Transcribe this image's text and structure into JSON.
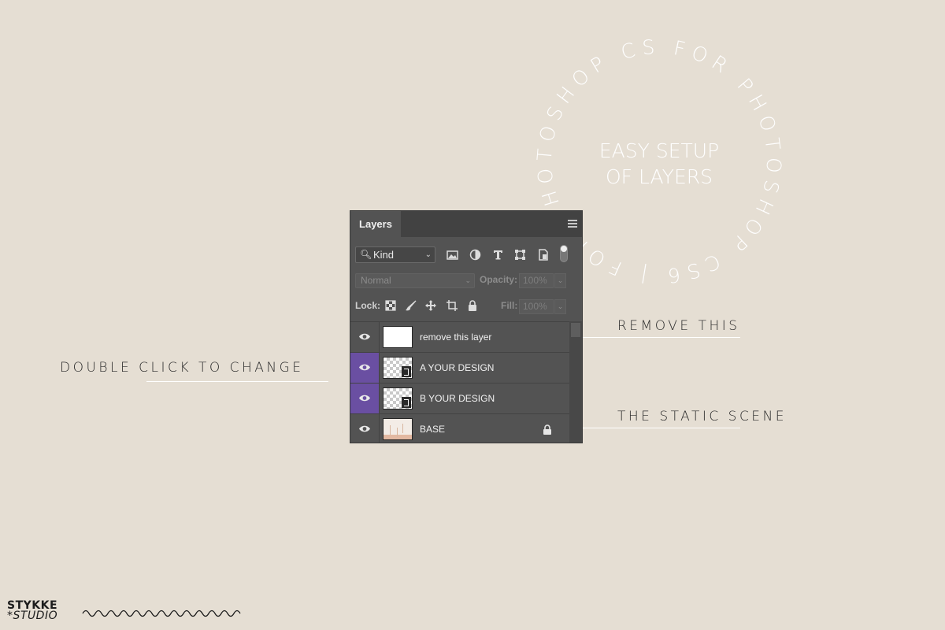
{
  "ring": {
    "text": "FOR PHOTOSHOP CS6 | FOR PHOTOSHOP CS6 | ",
    "center_line1": "EASY SETUP",
    "center_line2": "OF LAYERS"
  },
  "callouts": {
    "left": "DOUBLE CLICK TO CHANGE",
    "remove": "REMOVE THIS",
    "static": "THE STATIC SCENE"
  },
  "panel": {
    "tab_label": "Layers",
    "filter_kind": "Kind",
    "blend_mode": "Normal",
    "opacity_label": "Opacity:",
    "opacity_value": "100%",
    "lock_label": "Lock:",
    "fill_label": "Fill:",
    "fill_value": "100%",
    "layers": [
      {
        "name": "remove this layer",
        "selected": false,
        "thumb": "white",
        "locked": false
      },
      {
        "name": "A YOUR DESIGN",
        "selected": true,
        "thumb": "smart",
        "locked": false
      },
      {
        "name": "B YOUR DESIGN",
        "selected": true,
        "thumb": "smart",
        "locked": false
      },
      {
        "name": "BASE",
        "selected": false,
        "thumb": "base",
        "locked": true
      }
    ]
  },
  "brand": {
    "line1": "STYKKE",
    "line2": "*STUDIO"
  },
  "colors": {
    "background": "#e5ded3",
    "panel": "#535353",
    "selected_eye": "#6a4fa2",
    "annotation_line": "#ffffff"
  }
}
